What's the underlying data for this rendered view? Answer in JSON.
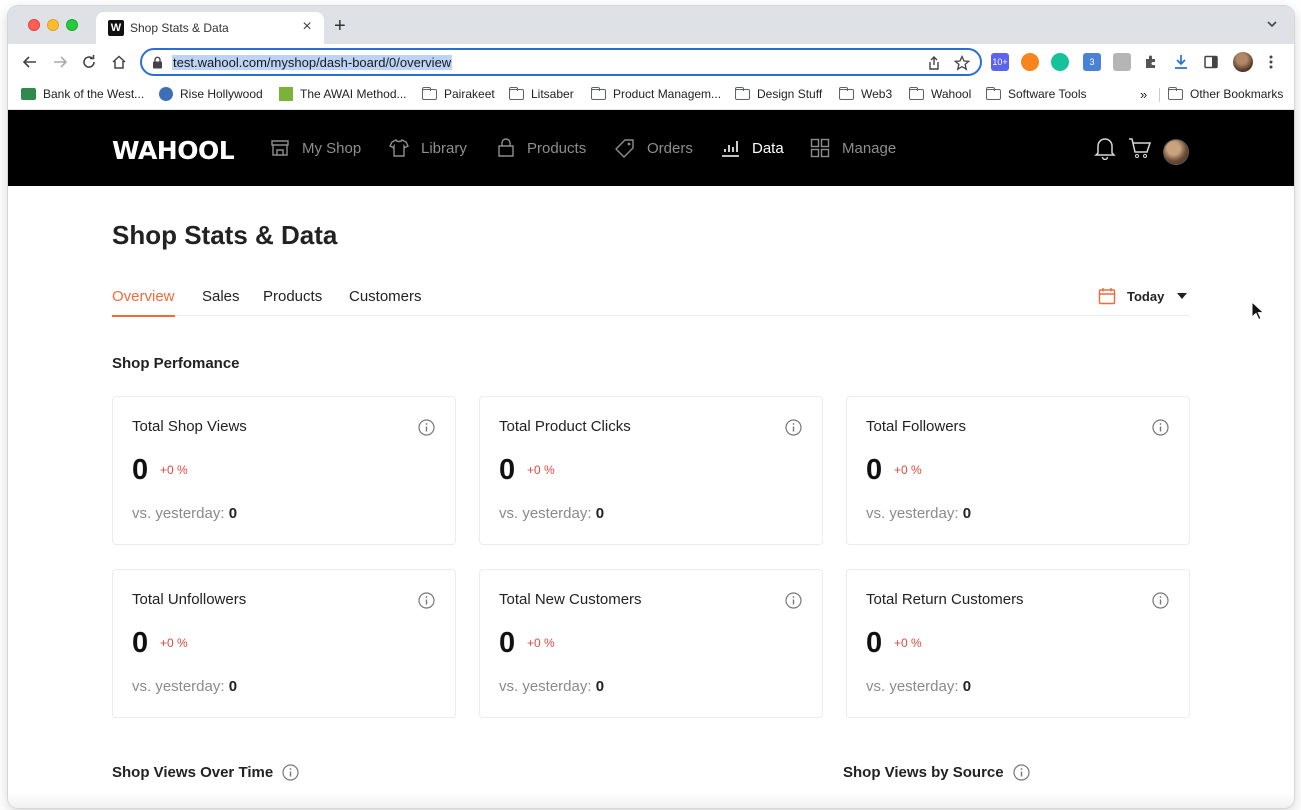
{
  "browser": {
    "tab_title": "Shop Stats & Data",
    "tab_favicon": "W",
    "tab_close": "×",
    "new_tab": "+",
    "url": "test.wahool.com/myshop/dash-board/0/overview",
    "extensions": [
      {
        "name": "extension-badge-icon",
        "label": "10+",
        "color": "#5b63f0"
      },
      {
        "name": "metamask-icon",
        "label": "",
        "color": "#f6851b"
      },
      {
        "name": "grammarly-icon",
        "label": "",
        "color": "#15c39a"
      },
      {
        "name": "code-extension-icon",
        "label": "3",
        "color": "#4a80d6"
      },
      {
        "name": "k-extension-icon",
        "label": "",
        "color": "#b5b5b5"
      }
    ],
    "bookmarks": [
      {
        "label": "Bank of the West...",
        "icon": "bank-icon"
      },
      {
        "label": "Rise Hollywood",
        "icon": "rise-icon"
      },
      {
        "label": "The AWAI Method...",
        "icon": "awai-icon"
      },
      {
        "label": "Pairakeet",
        "icon": "folder-icon"
      },
      {
        "label": "Litsaber",
        "icon": "folder-icon"
      },
      {
        "label": "Product Managem...",
        "icon": "folder-icon"
      },
      {
        "label": "Design Stuff",
        "icon": "folder-icon"
      },
      {
        "label": "Web3",
        "icon": "folder-icon"
      },
      {
        "label": "Wahool",
        "icon": "folder-icon"
      },
      {
        "label": "Software Tools",
        "icon": "folder-icon"
      }
    ],
    "bookmarks_overflow": "»",
    "other_bookmarks": "Other Bookmarks"
  },
  "site": {
    "logo": "WAHOOL",
    "nav": [
      {
        "label": "My Shop",
        "icon": "store-icon",
        "active": false
      },
      {
        "label": "Library",
        "icon": "shirt-icon",
        "active": false
      },
      {
        "label": "Products",
        "icon": "bag-icon",
        "active": false
      },
      {
        "label": "Orders",
        "icon": "tag-icon",
        "active": false
      },
      {
        "label": "Data",
        "icon": "bar-chart-icon",
        "active": true
      },
      {
        "label": "Manage",
        "icon": "grid-icon",
        "active": false
      }
    ]
  },
  "page": {
    "title": "Shop Stats & Data",
    "tabs": [
      "Overview",
      "Sales",
      "Products",
      "Customers"
    ],
    "active_tab": "Overview",
    "date_filter": "Today",
    "accent_color": "#f06a3a",
    "section_performance": "Shop Perfomance",
    "cards": [
      {
        "title": "Total Shop Views",
        "value": "0",
        "delta": "+0 %",
        "compare_label": "vs. yesterday:",
        "compare_value": "0"
      },
      {
        "title": "Total Product Clicks",
        "value": "0",
        "delta": "+0 %",
        "compare_label": "vs. yesterday:",
        "compare_value": "0"
      },
      {
        "title": "Total Followers",
        "value": "0",
        "delta": "+0 %",
        "compare_label": "vs. yesterday:",
        "compare_value": "0"
      },
      {
        "title": "Total Unfollowers",
        "value": "0",
        "delta": "+0 %",
        "compare_label": "vs. yesterday:",
        "compare_value": "0"
      },
      {
        "title": "Total New Customers",
        "value": "0",
        "delta": "+0 %",
        "compare_label": "vs. yesterday:",
        "compare_value": "0"
      },
      {
        "title": "Total Return Customers",
        "value": "0",
        "delta": "+0 %",
        "compare_label": "vs. yesterday:",
        "compare_value": "0"
      }
    ],
    "section_views_over_time": "Shop Views Over Time",
    "section_views_by_source": "Shop Views by Source"
  }
}
